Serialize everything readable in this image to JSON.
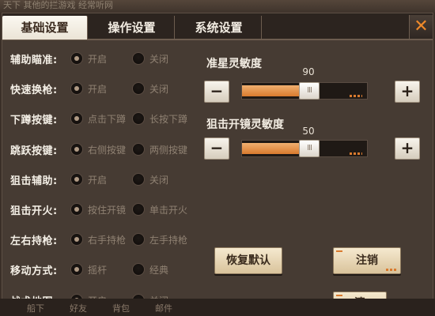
{
  "background": {
    "top_text": "天下    其他的拦游戏    经常听网",
    "bottom_items": [
      "船下",
      "好友",
      "背包",
      "邮件"
    ]
  },
  "tabs": [
    {
      "label": "基础设置",
      "active": true
    },
    {
      "label": "操作设置",
      "active": false
    },
    {
      "label": "系统设置",
      "active": false
    }
  ],
  "close_label": "✕",
  "settings": [
    {
      "label": "辅助瞄准:",
      "options": [
        "开启",
        "关闭"
      ],
      "selected": 0
    },
    {
      "label": "快速换枪:",
      "options": [
        "开启",
        "关闭"
      ],
      "selected": 0
    },
    {
      "label": "下蹲按键:",
      "options": [
        "点击下蹲",
        "长按下蹲"
      ],
      "selected": 0
    },
    {
      "label": "跳跃按键:",
      "options": [
        "右侧按键",
        "两侧按键"
      ],
      "selected": 0
    },
    {
      "label": "狙击辅助:",
      "options": [
        "开启",
        "关闭"
      ],
      "selected": 0
    },
    {
      "label": "狙击开火:",
      "options": [
        "按住开镜",
        "单击开火"
      ],
      "selected": 0
    },
    {
      "label": "左右持枪:",
      "options": [
        "右手持枪",
        "左手持枪"
      ],
      "selected": 0
    },
    {
      "label": "移动方式:",
      "options": [
        "摇杆",
        "经典"
      ],
      "selected": 0
    },
    {
      "label": "战术地图:",
      "options": [
        "开启",
        "关闭"
      ],
      "selected": 0
    }
  ],
  "sliders": [
    {
      "title": "准星灵敏度",
      "value": "90",
      "fraction": 0.5,
      "minus": "−",
      "plus": "+",
      "thumb": "III"
    },
    {
      "title": "狙击开镜灵敏度",
      "value": "50",
      "fraction": 0.5,
      "minus": "−",
      "plus": "+",
      "thumb": "III"
    }
  ],
  "buttons": {
    "reset": "恢复默认",
    "logout": "注销",
    "partial": "清"
  },
  "colors": {
    "accent": "#d97a2e",
    "panel": "#463b33",
    "tab_active": "#f5f0e6"
  }
}
